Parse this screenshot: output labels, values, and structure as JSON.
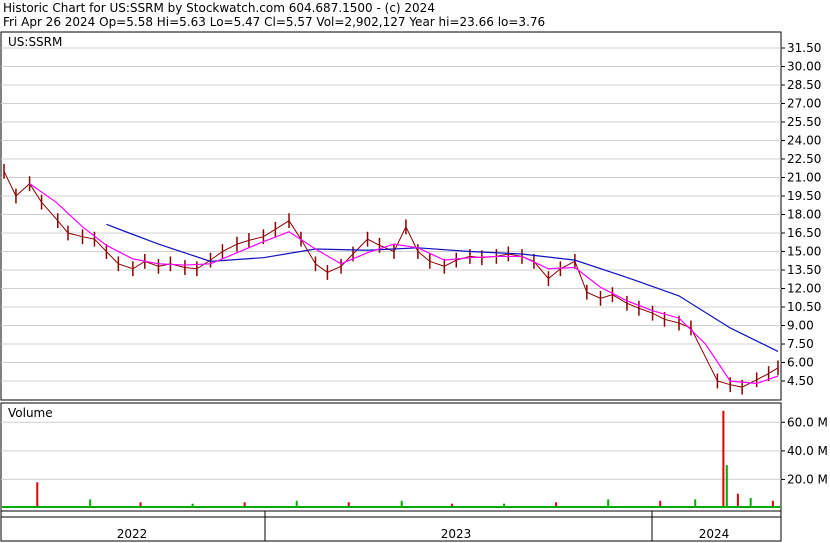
{
  "header": {
    "line1": "Historic Chart for US:SSRM by Stockwatch.com 604.687.1500 - (c) 2024",
    "line2": "Fri Apr 26 2024  Op=5.58  Hi=5.63  Lo=5.47  Cl=5.57  Vol=2,902,127  Year hi=23.66  lo=3.76"
  },
  "colors": {
    "price_bars": "#8b0000",
    "ma_short": "#ff00ff",
    "ma_long": "#1010c0",
    "vol_up": "#00aa00",
    "vol_down": "#dd0000",
    "grid": "#d0d0d0"
  },
  "chart_data": [
    {
      "type": "line",
      "title": "US:SSRM",
      "y_axis_side": "right",
      "y_ticks": [
        "31.50",
        "30.00",
        "28.50",
        "27.00",
        "25.50",
        "24.00",
        "22.50",
        "21.00",
        "19.50",
        "18.00",
        "16.50",
        "15.00",
        "13.50",
        "12.00",
        "10.50",
        "9.00",
        "7.50",
        "6.00",
        "4.50"
      ],
      "x_labels": [
        "2022",
        "2023",
        "2024"
      ],
      "grid": true,
      "series": [
        {
          "kind": "price-hlc",
          "points": [
            [
              "2021-11-01",
              21.5
            ],
            [
              "2021-11-15",
              19.5
            ],
            [
              "2021-12-01",
              20.5
            ],
            [
              "2021-12-15",
              19.0
            ],
            [
              "2022-01-03",
              17.5
            ],
            [
              "2022-01-15",
              16.5
            ],
            [
              "2022-02-01",
              16.2
            ],
            [
              "2022-02-15",
              16.0
            ],
            [
              "2022-03-01",
              15.0
            ],
            [
              "2022-03-15",
              14.0
            ],
            [
              "2022-04-01",
              13.6
            ],
            [
              "2022-04-15",
              14.2
            ],
            [
              "2022-05-01",
              13.8
            ],
            [
              "2022-05-15",
              14.0
            ],
            [
              "2022-06-01",
              13.7
            ],
            [
              "2022-06-15",
              13.6
            ],
            [
              "2022-07-01",
              14.3
            ],
            [
              "2022-07-15",
              15.0
            ],
            [
              "2022-08-01",
              15.6
            ],
            [
              "2022-08-15",
              15.9
            ],
            [
              "2022-09-01",
              16.2
            ],
            [
              "2022-09-15",
              16.8
            ],
            [
              "2022-10-01",
              17.5
            ],
            [
              "2022-10-15",
              16.0
            ],
            [
              "2022-11-01",
              14.0
            ],
            [
              "2022-11-15",
              13.3
            ],
            [
              "2022-12-01",
              13.8
            ],
            [
              "2022-12-15",
              14.8
            ],
            [
              "2023-01-01",
              16.0
            ],
            [
              "2023-01-15",
              15.5
            ],
            [
              "2023-02-01",
              15.0
            ],
            [
              "2023-02-15",
              17.0
            ],
            [
              "2023-03-01",
              15.0
            ],
            [
              "2023-03-15",
              14.2
            ],
            [
              "2023-04-01",
              13.8
            ],
            [
              "2023-04-15",
              14.3
            ],
            [
              "2023-05-01",
              14.6
            ],
            [
              "2023-05-15",
              14.5
            ],
            [
              "2023-06-01",
              14.6
            ],
            [
              "2023-06-15",
              14.8
            ],
            [
              "2023-07-01",
              14.6
            ],
            [
              "2023-07-15",
              14.2
            ],
            [
              "2023-08-01",
              12.8
            ],
            [
              "2023-08-15",
              13.6
            ],
            [
              "2023-09-01",
              14.2
            ],
            [
              "2023-09-15",
              11.7
            ],
            [
              "2023-10-01",
              11.2
            ],
            [
              "2023-10-15",
              11.5
            ],
            [
              "2023-11-01",
              10.8
            ],
            [
              "2023-11-15",
              10.4
            ],
            [
              "2023-12-01",
              10.0
            ],
            [
              "2023-12-15",
              9.5
            ],
            [
              "2024-01-01",
              9.2
            ],
            [
              "2024-01-15",
              8.8
            ],
            [
              "2024-02-15",
              4.5
            ],
            [
              "2024-03-01",
              4.2
            ],
            [
              "2024-03-15",
              4.0
            ],
            [
              "2024-04-01",
              4.6
            ],
            [
              "2024-04-15",
              5.1
            ],
            [
              "2024-04-26",
              5.57
            ]
          ]
        },
        {
          "kind": "moving-average-short",
          "points": [
            [
              "2021-12-01",
              20.5
            ],
            [
              "2022-01-01",
              19.0
            ],
            [
              "2022-02-01",
              17.0
            ],
            [
              "2022-03-01",
              15.5
            ],
            [
              "2022-04-01",
              14.4
            ],
            [
              "2022-05-01",
              14.0
            ],
            [
              "2022-06-01",
              13.9
            ],
            [
              "2022-07-01",
              14.0
            ],
            [
              "2022-08-01",
              14.9
            ],
            [
              "2022-09-01",
              15.8
            ],
            [
              "2022-10-01",
              16.6
            ],
            [
              "2022-11-01",
              15.2
            ],
            [
              "2022-12-01",
              14.0
            ],
            [
              "2023-01-01",
              14.9
            ],
            [
              "2023-02-01",
              15.6
            ],
            [
              "2023-03-01",
              15.3
            ],
            [
              "2023-04-01",
              14.3
            ],
            [
              "2023-05-01",
              14.5
            ],
            [
              "2023-06-01",
              14.6
            ],
            [
              "2023-07-01",
              14.6
            ],
            [
              "2023-08-01",
              13.6
            ],
            [
              "2023-09-01",
              13.7
            ],
            [
              "2023-10-01",
              12.1
            ],
            [
              "2023-11-01",
              11.0
            ],
            [
              "2023-12-01",
              10.2
            ],
            [
              "2024-01-01",
              9.6
            ],
            [
              "2024-02-01",
              7.5
            ],
            [
              "2024-03-01",
              4.5
            ],
            [
              "2024-04-01",
              4.3
            ],
            [
              "2024-04-26",
              4.9
            ]
          ]
        },
        {
          "kind": "moving-average-long",
          "points": [
            [
              "2022-03-01",
              17.2
            ],
            [
              "2022-05-01",
              15.6
            ],
            [
              "2022-07-01",
              14.2
            ],
            [
              "2022-09-01",
              14.5
            ],
            [
              "2022-11-01",
              15.2
            ],
            [
              "2023-01-01",
              15.1
            ],
            [
              "2023-03-01",
              15.3
            ],
            [
              "2023-05-01",
              15.0
            ],
            [
              "2023-07-01",
              14.8
            ],
            [
              "2023-09-01",
              14.3
            ],
            [
              "2023-11-01",
              12.9
            ],
            [
              "2024-01-01",
              11.4
            ],
            [
              "2024-03-01",
              8.8
            ],
            [
              "2024-04-26",
              6.9
            ]
          ]
        }
      ]
    },
    {
      "type": "bar",
      "title": "Volume",
      "y_ticks": [
        "60.0 M",
        "40.0 M",
        "20.0 M"
      ],
      "ylim": [
        0,
        70
      ],
      "x": [
        "2021-12-10",
        "2022-02-10",
        "2022-04-10",
        "2022-06-10",
        "2022-08-10",
        "2022-10-10",
        "2022-12-10",
        "2023-02-10",
        "2023-04-10",
        "2023-06-10",
        "2023-08-10",
        "2023-10-10",
        "2023-12-10",
        "2024-01-20",
        "2024-02-22",
        "2024-02-26",
        "2024-03-10",
        "2024-03-25",
        "2024-04-20"
      ],
      "values": [
        18,
        6,
        4,
        3,
        4,
        5,
        4,
        5,
        3,
        3,
        4,
        6,
        5,
        6,
        68,
        30,
        10,
        7,
        5
      ]
    }
  ]
}
